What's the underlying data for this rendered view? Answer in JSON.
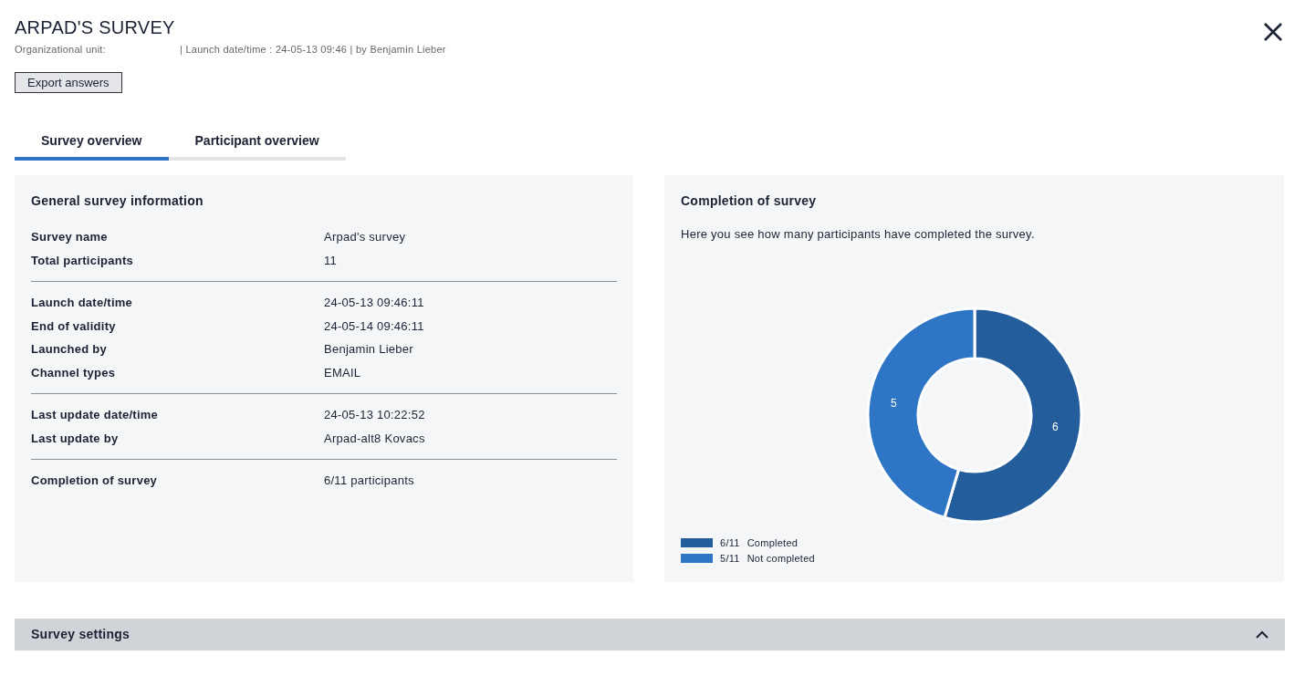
{
  "title": "ARPAD'S SURVEY",
  "meta": [
    "Organizational unit:",
    "| Launch date/time : 24-05-13 09:46 | by Benjamin Lieber"
  ],
  "export_button": "Export answers",
  "tabs": [
    {
      "label": "Survey overview",
      "selected": true
    },
    {
      "label": "Participant overview",
      "selected": false
    }
  ],
  "general_info": {
    "heading": "General survey information",
    "sections": [
      [
        {
          "label": "Survey name",
          "value": "Arpad's survey"
        },
        {
          "label": "Total participants",
          "value": "11"
        }
      ],
      [
        {
          "label": "Launch date/time",
          "value": "24-05-13 09:46:11"
        },
        {
          "label": "End of validity",
          "value": "24-05-14 09:46:11"
        },
        {
          "label": "Launched by",
          "value": "Benjamin Lieber"
        },
        {
          "label": "Channel types",
          "value": "EMAIL"
        }
      ],
      [
        {
          "label": "Last update date/time",
          "value": "24-05-13 10:22:52"
        },
        {
          "label": "Last update by",
          "value": "Arpad-alt8 Kovacs"
        }
      ],
      [
        {
          "label": "Completion of survey",
          "value": "6/11 participants"
        }
      ]
    ]
  },
  "completion": {
    "heading": "Completion of survey",
    "description": "Here you see how many participants have completed the survey.",
    "chart_data": {
      "type": "donut",
      "categories": [
        "Completed",
        "Not completed"
      ],
      "series": [
        {
          "values": [
            6,
            5
          ]
        }
      ],
      "data_labels": true
    },
    "legend": [
      {
        "count": "6/11",
        "color": "#245d9c"
      },
      {
        "count": "5/11",
        "color": "#2f75c5"
      }
    ]
  },
  "settings_panel": {
    "title": "Survey settings",
    "expanded": true
  }
}
